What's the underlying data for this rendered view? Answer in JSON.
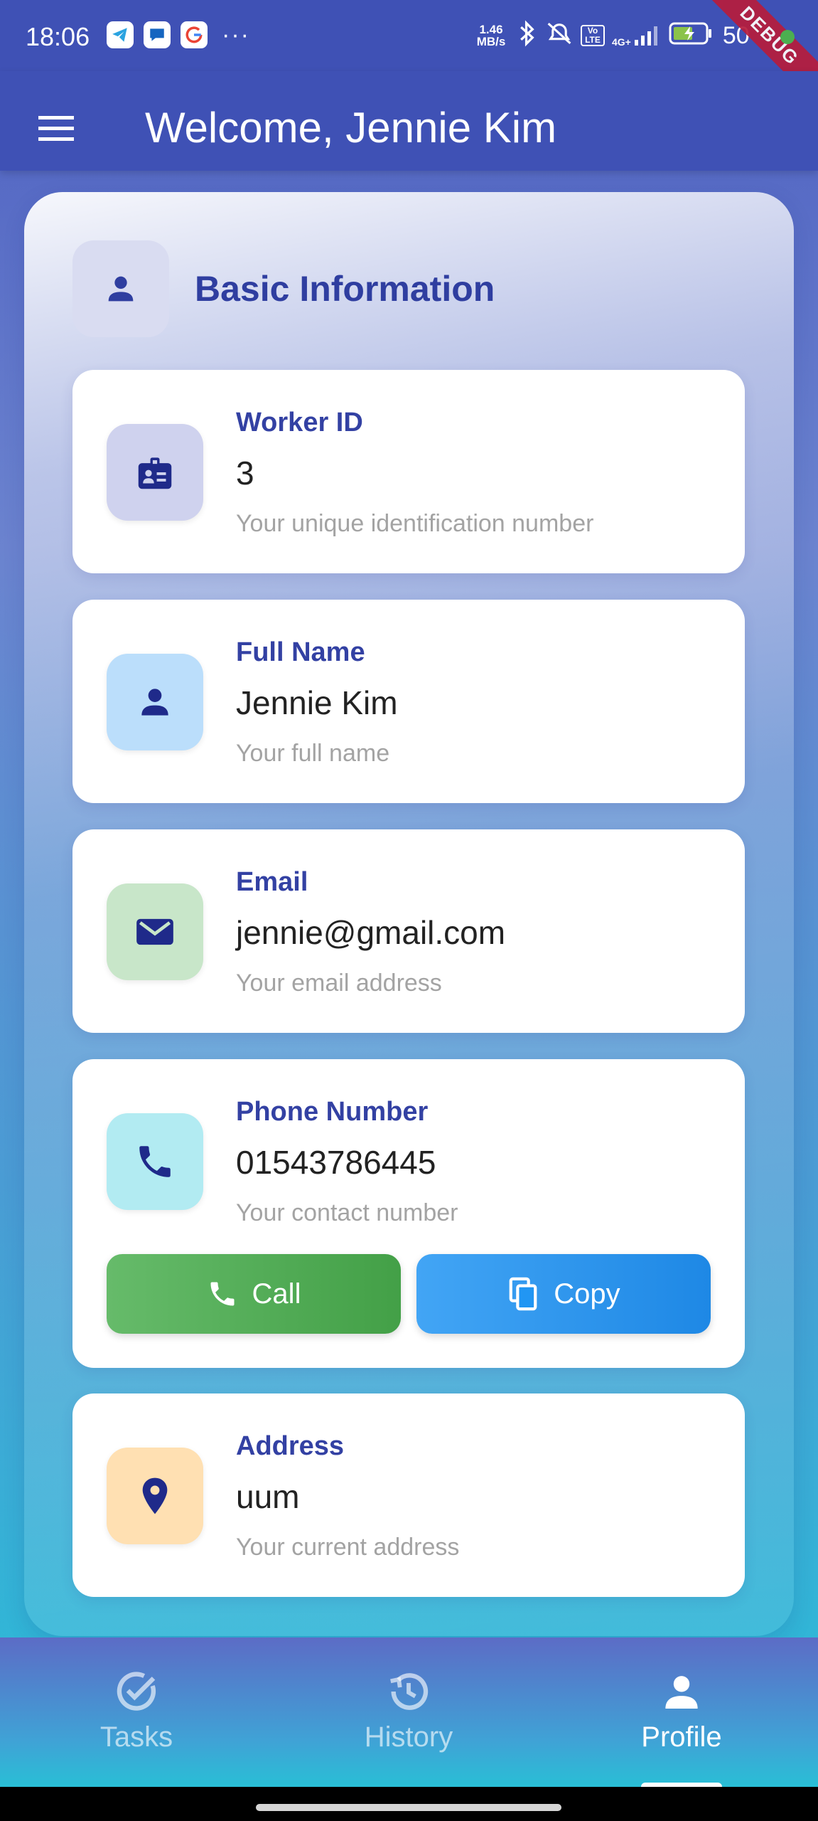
{
  "status_bar": {
    "time": "18:06",
    "more": "···",
    "net_speed_value": "1.46",
    "net_speed_unit": "MB/s",
    "volte_label": "Vo LTE",
    "network_type": "4G+",
    "battery_level": "50",
    "debug_label": "DEBUG"
  },
  "app_bar": {
    "title": "Welcome, Jennie Kim"
  },
  "section": {
    "title": "Basic Information"
  },
  "cards": [
    {
      "label": "Worker ID",
      "value": "3",
      "hint": "Your unique identification number",
      "icon": "badge-icon",
      "icon_bg": "#cfd2ee"
    },
    {
      "label": "Full Name",
      "value": "Jennie Kim",
      "hint": "Your full name",
      "icon": "person-icon",
      "icon_bg": "#bbdefb"
    },
    {
      "label": "Email",
      "value": "jennie@gmail.com",
      "hint": "Your email address",
      "icon": "mail-icon",
      "icon_bg": "#c8e6c9"
    },
    {
      "label": "Phone Number",
      "value": "01543786445",
      "hint": "Your contact number",
      "icon": "phone-icon",
      "icon_bg": "#b2ebf2",
      "actions": {
        "call_label": "Call",
        "copy_label": "Copy"
      }
    },
    {
      "label": "Address",
      "value": "uum",
      "hint": "Your current address",
      "icon": "location-pin-icon",
      "icon_bg": "#ffe0b2"
    }
  ],
  "bottom_nav": {
    "items": [
      {
        "label": "Tasks",
        "icon": "task-check-icon",
        "active": false
      },
      {
        "label": "History",
        "icon": "history-icon",
        "active": false
      },
      {
        "label": "Profile",
        "icon": "person-icon",
        "active": true
      }
    ]
  },
  "colors": {
    "primary": "#3f51b5",
    "label": "#3341a3",
    "call_button": "#4caf50",
    "copy_button": "#2196f3"
  }
}
